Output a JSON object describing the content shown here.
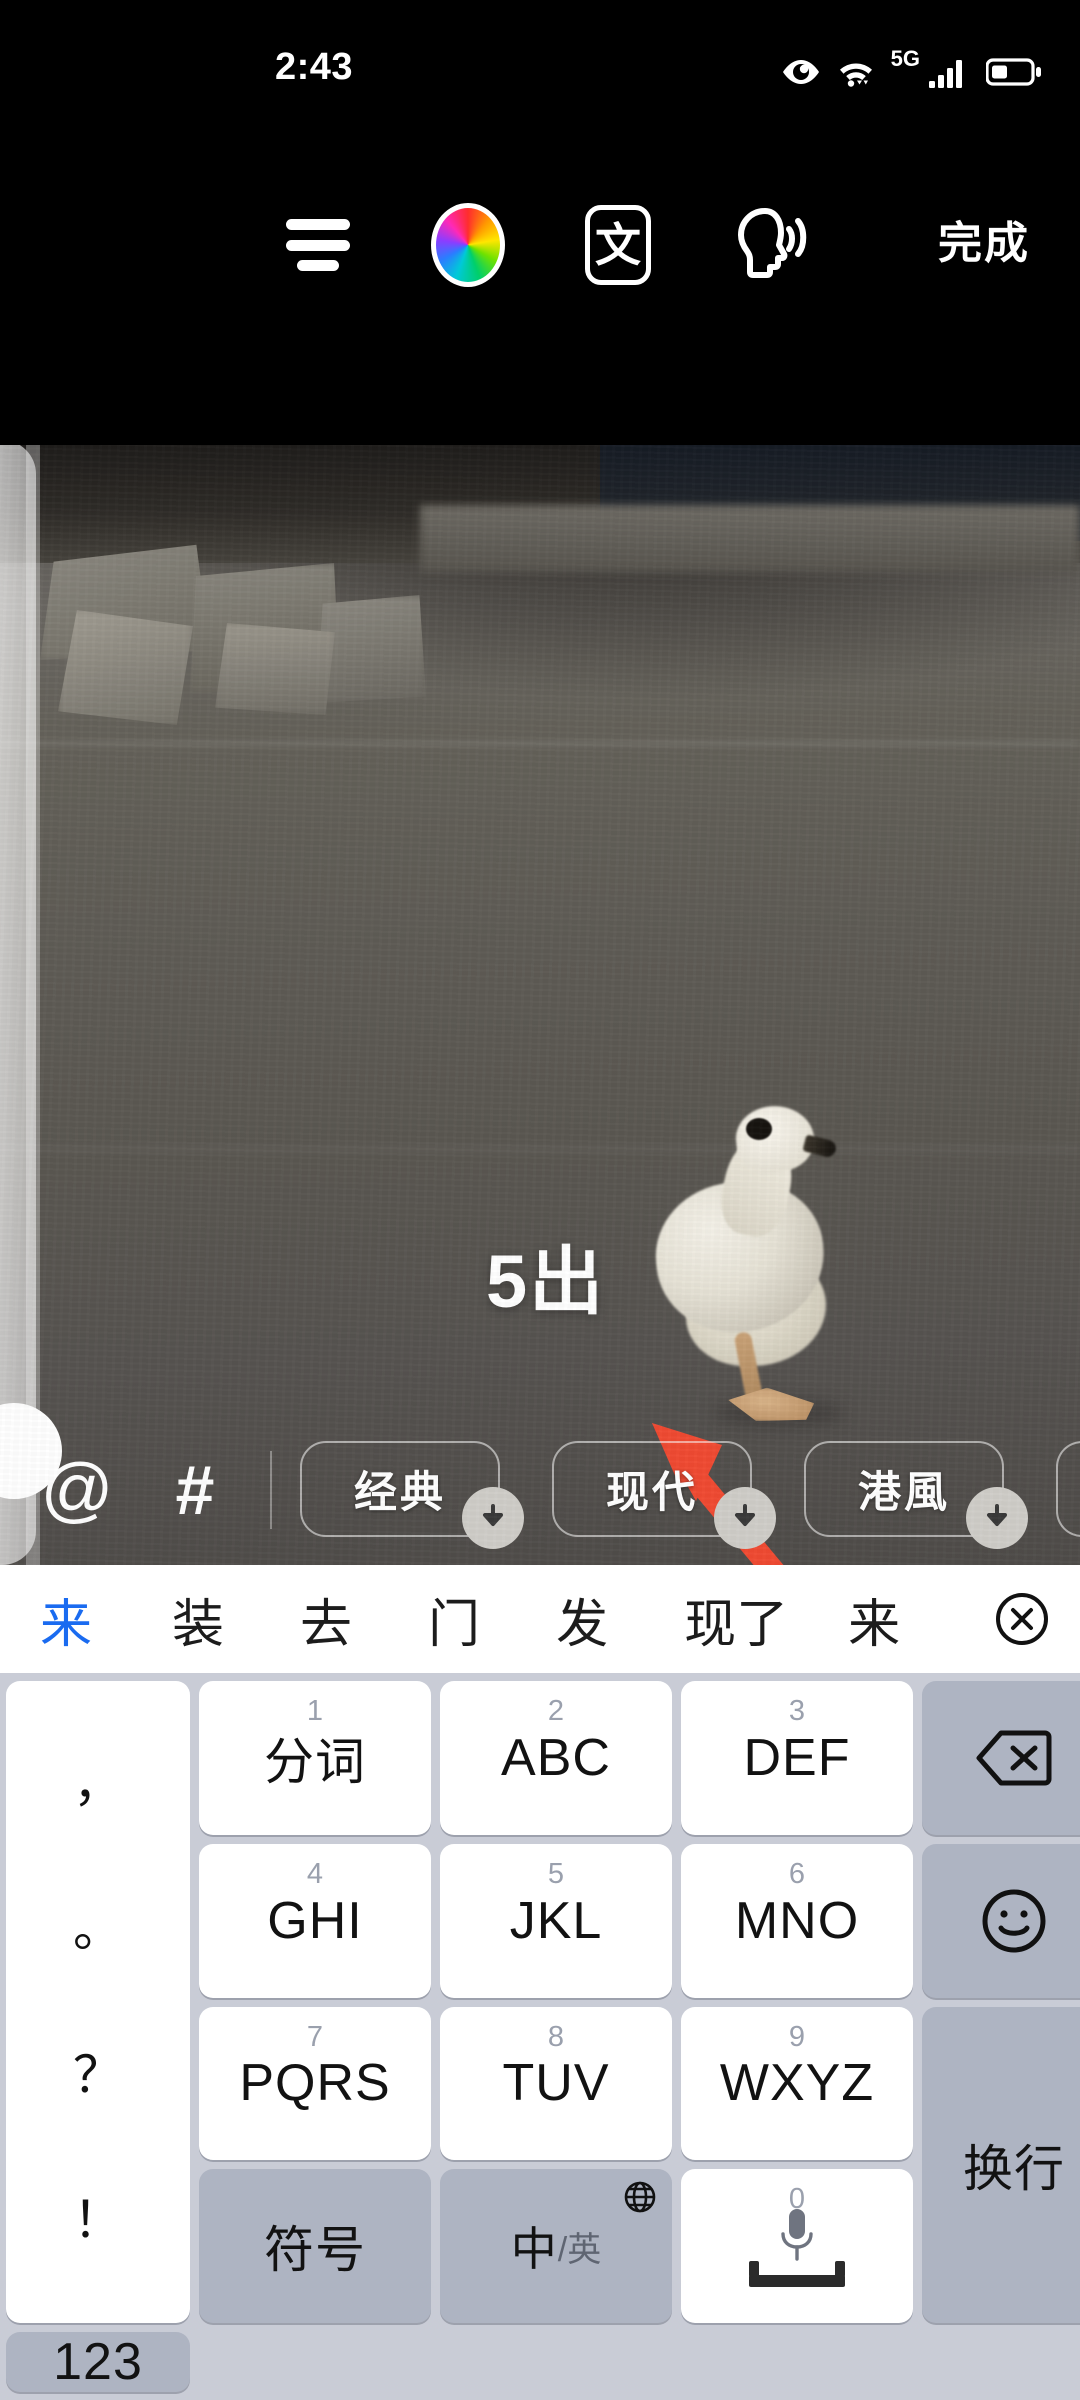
{
  "status_bar": {
    "time": "2:43",
    "icons": [
      "eye-care-icon",
      "wifi-icon",
      "5g-label",
      "signal-bars-icon",
      "battery-icon"
    ],
    "network_label": "5G"
  },
  "toolbar": {
    "align_icon": "text-align-icon",
    "color_icon": "color-wheel-icon",
    "font_icon_label": "文",
    "voice_icon": "text-to-speech-icon",
    "done_label": "完成"
  },
  "canvas": {
    "caption_text": "5出",
    "annotation": {
      "type": "arrow",
      "color": "#F04A32",
      "direction": "up-left"
    },
    "drag_handle": "left-edge-handle"
  },
  "chip_bar": {
    "mention_label": "@",
    "hashtag_label": "#",
    "chips": [
      {
        "label": "经典",
        "badge": "download-icon"
      },
      {
        "label": "现代",
        "badge": "download-icon"
      },
      {
        "label": "港風",
        "badge": "download-icon"
      },
      {
        "label": "",
        "badge": "download-icon"
      }
    ]
  },
  "keyboard": {
    "candidates": [
      "来",
      "装",
      "去",
      "门",
      "发",
      "现了",
      "来"
    ],
    "selected_candidate": "来",
    "close_label": "⊗",
    "punct_key": [
      "，",
      "。",
      "？",
      "！"
    ],
    "keys": [
      {
        "sub": "1",
        "main": "分词"
      },
      {
        "sub": "2",
        "main": "ABC"
      },
      {
        "sub": "3",
        "main": "DEF"
      },
      {
        "sub": "4",
        "main": "GHI"
      },
      {
        "sub": "5",
        "main": "JKL"
      },
      {
        "sub": "6",
        "main": "MNO"
      },
      {
        "sub": "7",
        "main": "PQRS"
      },
      {
        "sub": "8",
        "main": "TUV"
      },
      {
        "sub": "9",
        "main": "WXYZ"
      }
    ],
    "backspace_icon": "backspace-icon",
    "emoji_icon": "emoji-icon",
    "enter_label": "换行",
    "symbol_label": "符号",
    "lang_cn": "中",
    "lang_en": "/英",
    "globe_icon": "globe-icon",
    "space_sub": "0",
    "space_icon": "microphone-icon",
    "num_label": "123"
  },
  "colors": {
    "accent_blue": "#1a6bf0",
    "arrow_red": "#F04A32",
    "key_white": "#ffffff",
    "key_grey": "#aeb4c2",
    "keyboard_bg": "#c9ccd6"
  }
}
